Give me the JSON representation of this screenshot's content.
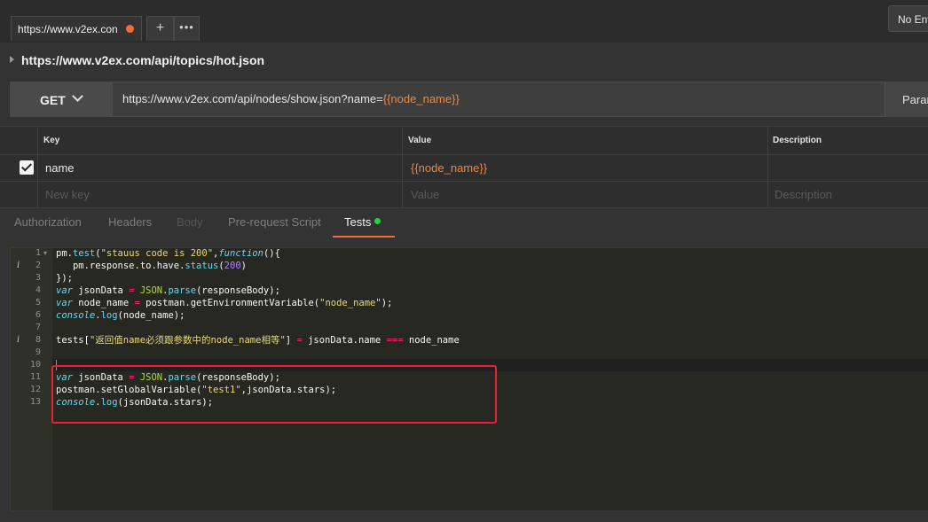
{
  "tabs": {
    "active_label": "https://www.v2ex.con",
    "plus_label": "+",
    "more_label": "•••",
    "environment_label": "No Environment"
  },
  "request": {
    "name": "https://www.v2ex.com/api/topics/hot.json",
    "method": "GET",
    "url_prefix": "https://www.v2ex.com/api/nodes/show.json?name=",
    "url_variable": "{{node_name}}",
    "params_label": "Params"
  },
  "params_table": {
    "headers": {
      "key": "Key",
      "value": "Value",
      "description": "Description"
    },
    "row": {
      "checked": true,
      "key": "name",
      "value": "{{node_name}}",
      "description": ""
    },
    "new_row": {
      "key_placeholder": "New key",
      "value_placeholder": "Value",
      "description_placeholder": "Description"
    }
  },
  "subtabs": [
    "Authorization",
    "Headers",
    "Body",
    "Pre-request Script",
    "Tests"
  ],
  "active_subtab": "Tests",
  "editor": {
    "line_numbers": [
      "1",
      "2",
      "3",
      "4",
      "5",
      "6",
      "7",
      "8",
      "9",
      "10",
      "11",
      "12",
      "13"
    ],
    "lines": [
      "pm.test(\"stauus code is 200\",function(){",
      "   pm.response.to.have.status(200)",
      "});",
      "var jsonData = JSON.parse(responseBody);",
      "var node_name = postman.getEnvironmentVariable(\"node_name\");",
      "console.log(node_name);",
      "",
      "tests[\"返回值name必须跟参数中的node_name相等\"] = jsonData.name === node_name",
      "",
      "",
      "var jsonData = JSON.parse(responseBody);",
      "postman.setGlobalVariable(\"test1\",jsonData.stars);",
      "console.log(jsonData.stars);"
    ],
    "info_marker": "i",
    "fold_marker": "▾"
  },
  "colors": {
    "accent": "#f26b3a",
    "annotation_box": "#e8232f",
    "status_dot": "#2ecc40"
  }
}
